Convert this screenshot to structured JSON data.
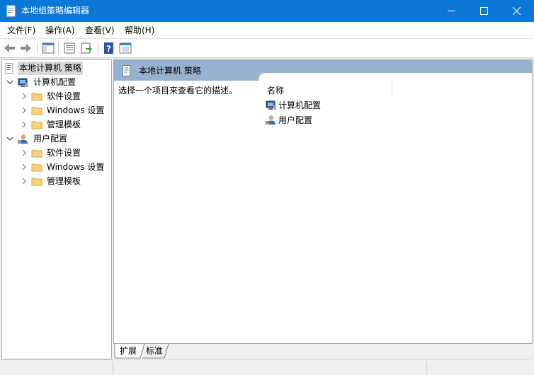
{
  "window": {
    "title": "本地组策略编辑器"
  },
  "menu": [
    {
      "label": "文件(F)"
    },
    {
      "label": "操作(A)"
    },
    {
      "label": "查看(V)"
    },
    {
      "label": "帮助(H)"
    }
  ],
  "toolbar": {
    "buttons": [
      "back-icon",
      "forward-icon",
      "show-hide-tree-icon",
      "properties-icon",
      "export-list-icon",
      "help-icon",
      "show-hide-action-pane-icon"
    ]
  },
  "tree": {
    "root": "本地计算机 策略",
    "computer_config": {
      "label": "计算机配置",
      "children": [
        "软件设置",
        "Windows 设置",
        "管理模板"
      ]
    },
    "user_config": {
      "label": "用户配置",
      "children": [
        "软件设置",
        "Windows 设置",
        "管理模板"
      ]
    }
  },
  "right": {
    "header": "本地计算机 策略",
    "description": "选择一个项目来查看它的描述。",
    "column_name": "名称",
    "items": [
      "计算机配置",
      "用户配置"
    ]
  },
  "tabs": [
    "扩展",
    "标准"
  ],
  "colors": {
    "titlebar": "#0b78d7",
    "pane_header": "#97b2ce",
    "selection": "#d9d9d9",
    "folder": "#f4d37a"
  }
}
